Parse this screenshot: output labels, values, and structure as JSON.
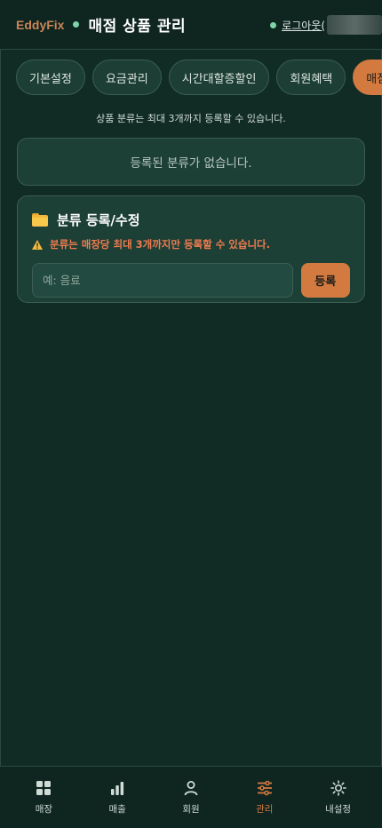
{
  "header": {
    "brand": "EddyFix",
    "title": "매점 상품 관리",
    "logout_label": "로그아웃("
  },
  "tabs": [
    {
      "label": "기본설정",
      "active": false
    },
    {
      "label": "요금관리",
      "active": false
    },
    {
      "label": "시간대할증할인",
      "active": false
    },
    {
      "label": "회원혜택",
      "active": false
    },
    {
      "label": "매점",
      "active": true
    }
  ],
  "notice": "상품 분류는 최대 3개까지 등록할 수 있습니다.",
  "empty_message": "등록된 분류가 없습니다.",
  "register_card": {
    "title": "분류 등록/수정",
    "warning": "분류는 매장당 최대 3개까지만 등록할 수 있습니다.",
    "input_placeholder": "예: 음료",
    "input_value": "",
    "submit_label": "등록"
  },
  "bottom_nav": [
    {
      "label": "매장",
      "icon": "grid-icon",
      "active": false
    },
    {
      "label": "매출",
      "icon": "bar-chart-icon",
      "active": false
    },
    {
      "label": "회원",
      "icon": "user-icon",
      "active": false
    },
    {
      "label": "관리",
      "icon": "sliders-icon",
      "active": true
    },
    {
      "label": "내설정",
      "icon": "gear-icon",
      "active": false
    }
  ],
  "colors": {
    "background": "#112b25",
    "accent": "#d27a3f",
    "status_dot": "#7fd3a6",
    "warning": "#f07b4f"
  }
}
